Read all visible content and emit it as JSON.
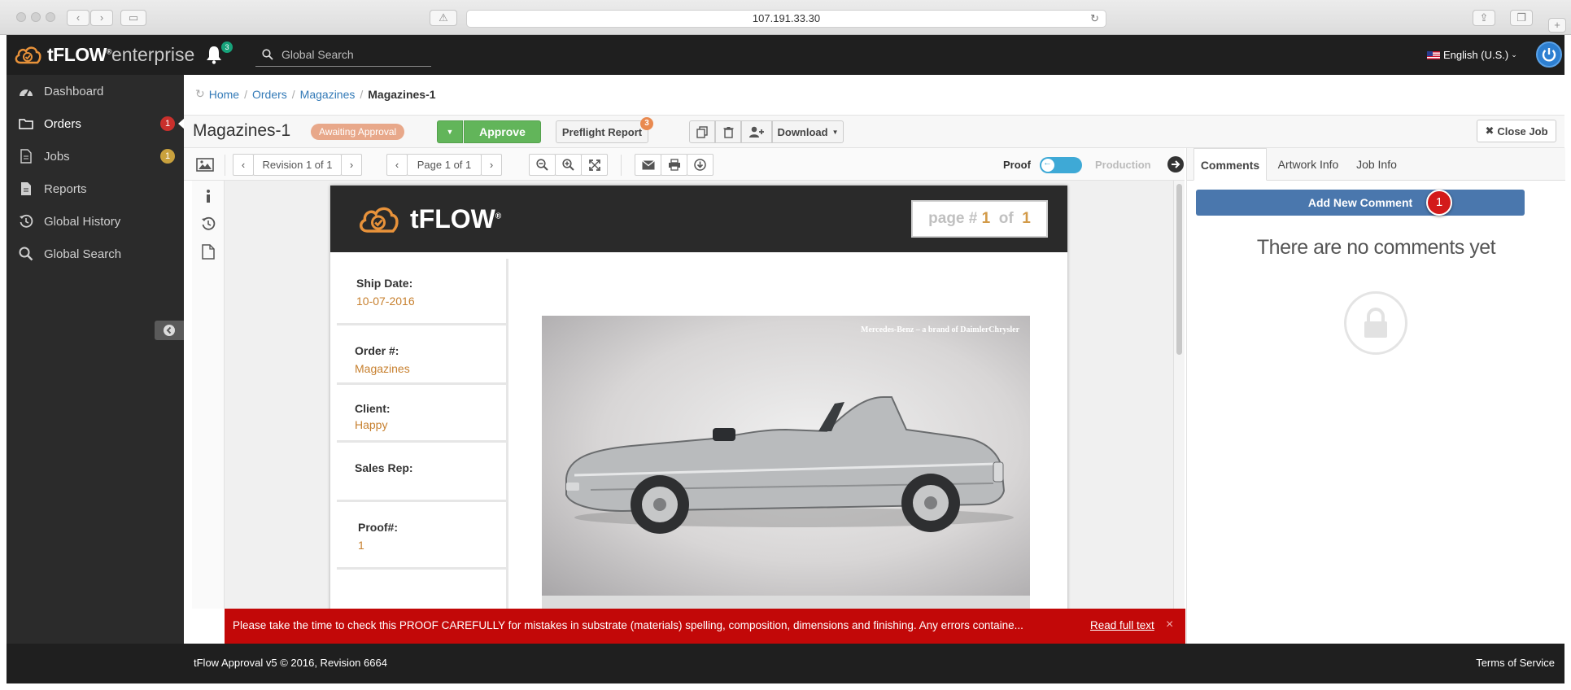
{
  "browser": {
    "address": "107.191.33.30"
  },
  "header": {
    "logo_bold": "tFLOW",
    "logo_mark": "®",
    "logo_light": "enterprise",
    "notifications_count": "3",
    "search_placeholder": "Global Search",
    "language": "English (U.S.)"
  },
  "sidebar": {
    "items": [
      {
        "label": "Dashboard",
        "icon": "dashboard-icon"
      },
      {
        "label": "Orders",
        "icon": "folder-icon",
        "badge": "1"
      },
      {
        "label": "Jobs",
        "icon": "file-icon",
        "badge": "1"
      },
      {
        "label": "Reports",
        "icon": "document-icon"
      },
      {
        "label": "Global History",
        "icon": "history-icon"
      },
      {
        "label": "Global Search",
        "icon": "search-icon"
      }
    ]
  },
  "breadcrumb": {
    "items": [
      "Home",
      "Orders",
      "Magazines"
    ],
    "current": "Magazines-1"
  },
  "job": {
    "title": "Magazines-1",
    "status": "Awaiting Approval",
    "approve_label": "Approve",
    "preflight_label": "Preflight Report",
    "preflight_count": "3",
    "download_label": "Download",
    "close_label": "Close Job"
  },
  "viewer": {
    "revision": "Revision 1 of 1",
    "page": "Page 1 of 1",
    "proof_label": "Proof",
    "production_label": "Production"
  },
  "proof_page": {
    "logo": "tFLOW",
    "logo_mark": "®",
    "page_prefix": "page #",
    "page_num": "1",
    "page_of": "of",
    "page_total": "1",
    "fields": [
      {
        "label": "Ship Date:",
        "value": "10-07-2016"
      },
      {
        "label": "Order #:",
        "value": "Magazines"
      },
      {
        "label": "Client:",
        "value": "Happy"
      },
      {
        "label": "Sales Rep:",
        "value": ""
      },
      {
        "label": "Proof#:",
        "value": "1"
      }
    ],
    "photo_caption": "Mercedes-Benz – a brand of DaimlerChrysler"
  },
  "warning": {
    "text": "Please take the time to check this PROOF CAREFULLY for mistakes in substrate (materials) spelling, composition, dimensions and finishing. Any errors containe...",
    "link": "Read full text",
    "close": "×"
  },
  "right_panel": {
    "tabs": [
      "Comments",
      "Artwork Info",
      "Job Info"
    ],
    "add_comment": "Add New Comment",
    "callout": "1",
    "empty_text": "There are no comments yet"
  },
  "footer": {
    "left": "tFlow Approval v5 © 2016, Revision 6664",
    "right": "Terms of Service"
  },
  "colors": {
    "header_bg": "#1f1f1f",
    "sidebar_bg": "#2b2b2b",
    "approve_green": "#62b55a",
    "status_pill": "#e8a88a",
    "warning_red": "#c20808",
    "primary_blue": "#4a77ad",
    "accent_orange": "#c7802f"
  }
}
